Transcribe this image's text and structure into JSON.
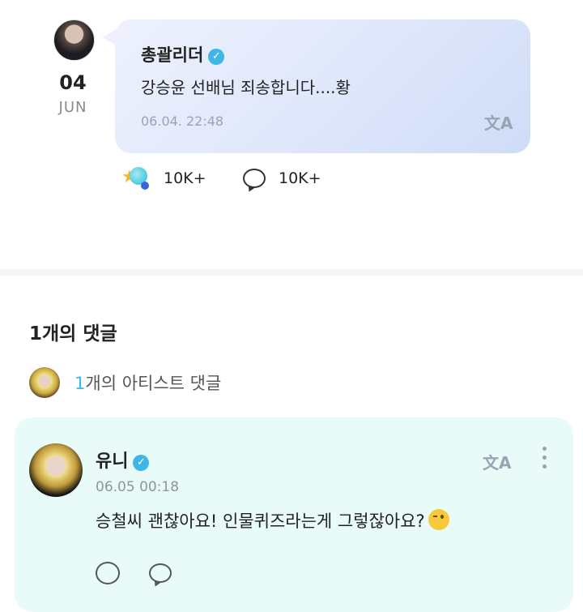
{
  "post": {
    "date_day": "04",
    "date_month": "JUN",
    "author": "총괄리더",
    "text": "강승윤 선배님 죄송합니다....황",
    "timestamp": "06.04. 22:48",
    "translate_glyph": "文A",
    "reactions_count": "10K+",
    "comments_count": "10K+"
  },
  "comments": {
    "title": "1개의 댓글",
    "artist_count": "1",
    "artist_label": "개의 아티스트 댓글"
  },
  "comment": {
    "author": "유니",
    "timestamp": "06.05 00:18",
    "text": "승철씨 괜찮아요! 인물퀴즈라는게 그렇잖아요?",
    "translate_glyph": "文A"
  },
  "colors": {
    "verified": "#3fb6e8",
    "comment_card_bg": "#e9fbf8",
    "accent": "#3fb6e8"
  },
  "icons": [
    "verified-icon",
    "translate-icon",
    "reaction-star-icon",
    "comment-bubble-icon",
    "more-vertical-icon",
    "wink-emoji-icon"
  ]
}
